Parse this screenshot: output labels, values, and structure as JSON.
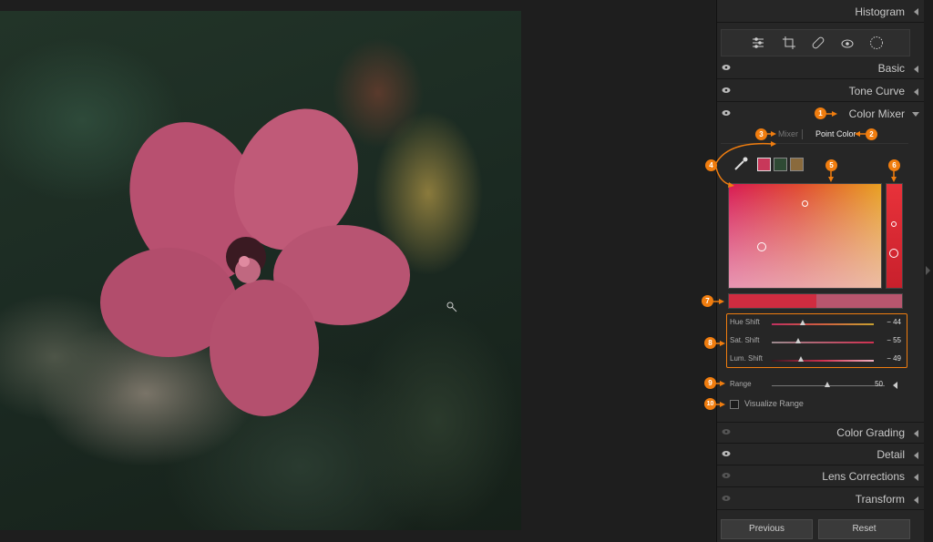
{
  "panel": {
    "histogram_title": "Histogram",
    "sections": {
      "basic": "Basic",
      "tone_curve": "Tone Curve",
      "color_mixer": "Color Mixer",
      "color_grading": "Color Grading",
      "detail": "Detail",
      "lens_corrections": "Lens Corrections",
      "transform": "Transform"
    },
    "tools": [
      "sliders-icon",
      "crop-icon",
      "healing-icon",
      "redeye-icon",
      "masking-icon"
    ]
  },
  "color_mixer": {
    "tabs": {
      "mixer": "Mixer",
      "point_color": "Point Color"
    },
    "swatches": [
      "#c8385a",
      "#2e4a34",
      "#8a6a3c"
    ],
    "sliders": [
      {
        "label": "Hue Shift",
        "value": "− 44",
        "level": 0.3
      },
      {
        "label": "Sat. Shift",
        "value": "− 55",
        "level": 0.25
      },
      {
        "label": "Lum. Shift",
        "value": "− 49",
        "level": 0.28
      }
    ],
    "range": {
      "label": "Range",
      "value": "50",
      "level": 0.5
    },
    "visualize_range": "Visualize Range"
  },
  "annotations": [
    "1",
    "2",
    "3",
    "4",
    "5",
    "6",
    "7",
    "8",
    "9",
    "10"
  ],
  "buttons": {
    "previous": "Previous",
    "reset": "Reset"
  },
  "colors": {
    "accent": "#f07d0f",
    "panel_bg": "#262626"
  }
}
